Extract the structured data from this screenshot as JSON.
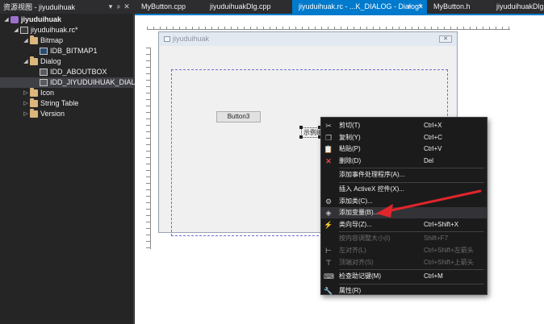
{
  "resource_view": {
    "title": "资源视图 - jiyuduihuak",
    "controls": {
      "dropdown": "▾",
      "pin": "ᵖ",
      "close": "✕"
    },
    "tree": [
      {
        "label": "jiyuduihuak",
        "bold": true,
        "level": 0,
        "toggle": "◢",
        "icon": "solution-icon"
      },
      {
        "label": "jiyuduihuak.rc*",
        "level": 1,
        "toggle": "◢",
        "icon": "resource-file-icon"
      },
      {
        "label": "Bitmap",
        "level": 2,
        "toggle": "◢",
        "icon": "folder-icon"
      },
      {
        "label": "IDB_BITMAP1",
        "level": 3,
        "toggle": "",
        "icon": "bitmap-icon"
      },
      {
        "label": "Dialog",
        "level": 2,
        "toggle": "◢",
        "icon": "folder-icon"
      },
      {
        "label": "IDD_ABOUTBOX",
        "level": 3,
        "toggle": "",
        "icon": "dialog-resource-icon"
      },
      {
        "label": "IDD_JIYUDUIHUAK_DIALOG",
        "level": 3,
        "toggle": "",
        "icon": "dialog-resource-icon",
        "selected": true
      },
      {
        "label": "Icon",
        "level": 2,
        "toggle": "▷",
        "icon": "folder-icon"
      },
      {
        "label": "String Table",
        "level": 2,
        "toggle": "▷",
        "icon": "folder-icon"
      },
      {
        "label": "Version",
        "level": 2,
        "toggle": "▷",
        "icon": "folder-icon"
      }
    ]
  },
  "tabs": [
    {
      "label": "MyButton.cpp",
      "active": false
    },
    {
      "label": "jiyuduihuakDlg.cpp",
      "active": false
    },
    {
      "label": "jiyuduihuak.rc - ...K_DIALOG - Dialog*",
      "active": true
    },
    {
      "label": "MyButton.h",
      "active": false
    },
    {
      "label": "jiyuduihuakDlg.h",
      "active": false
    }
  ],
  "tab_controls": {
    "pin": "ᵖ",
    "close": "✕"
  },
  "dialog": {
    "title": "jiyuduihuak",
    "close_glyph": "✕",
    "button3": "Button3",
    "static_text": "示例编辑框"
  },
  "context_menu": {
    "items": [
      {
        "label": "剪切(T)",
        "shortcut": "Ctrl+X",
        "icon": "scissors-icon",
        "glyph": "✂",
        "disabled": false
      },
      {
        "label": "复制(Y)",
        "shortcut": "Ctrl+C",
        "icon": "copy-icon",
        "glyph": "❐",
        "disabled": false
      },
      {
        "label": "粘贴(P)",
        "shortcut": "Ctrl+V",
        "icon": "paste-icon",
        "glyph": "📋",
        "disabled": false
      },
      {
        "label": "删除(D)",
        "shortcut": "Del",
        "icon": "delete-icon",
        "glyph": "✕",
        "red": true,
        "disabled": false
      },
      {
        "separator": true
      },
      {
        "label": "添加事件处理程序(A)...",
        "shortcut": "",
        "icon": "",
        "glyph": "",
        "disabled": false
      },
      {
        "separator": true
      },
      {
        "label": "插入 ActiveX 控件(X)...",
        "shortcut": "",
        "icon": "",
        "glyph": "",
        "disabled": false
      },
      {
        "label": "添加类(C)...",
        "shortcut": "",
        "icon": "add-class-icon",
        "glyph": "⚙",
        "disabled": false
      },
      {
        "label": "添加变量(B)...",
        "shortcut": "",
        "icon": "add-variable-icon",
        "glyph": "◈",
        "disabled": false,
        "highlight": true
      },
      {
        "label": "类向导(Z)...",
        "shortcut": "Ctrl+Shift+X",
        "icon": "class-wizard-icon",
        "glyph": "⚡",
        "disabled": false
      },
      {
        "separator": true
      },
      {
        "label": "按内容调整大小(I)",
        "shortcut": "Shift+F7",
        "icon": "",
        "glyph": "",
        "disabled": true
      },
      {
        "label": "左对齐(L)",
        "shortcut": "Ctrl+Shift+左箭头",
        "icon": "align-left-icon",
        "glyph": "⊢",
        "disabled": true
      },
      {
        "label": "顶端对齐(S)",
        "shortcut": "Ctrl+Shift+上箭头",
        "icon": "align-top-icon",
        "glyph": "⊤",
        "disabled": true
      },
      {
        "separator": true
      },
      {
        "label": "检查助记键(M)",
        "shortcut": "Ctrl+M",
        "icon": "check-mnemonics-icon",
        "glyph": "⌨",
        "disabled": false
      },
      {
        "separator": true
      },
      {
        "label": "属性(R)",
        "shortcut": "",
        "icon": "wrench-icon",
        "glyph": "🔧",
        "disabled": false
      }
    ]
  },
  "colors": {
    "accent": "#007acc",
    "arrow": "#e0252b",
    "menu_bg": "#1b1b1c",
    "panel_bg": "#252526"
  }
}
